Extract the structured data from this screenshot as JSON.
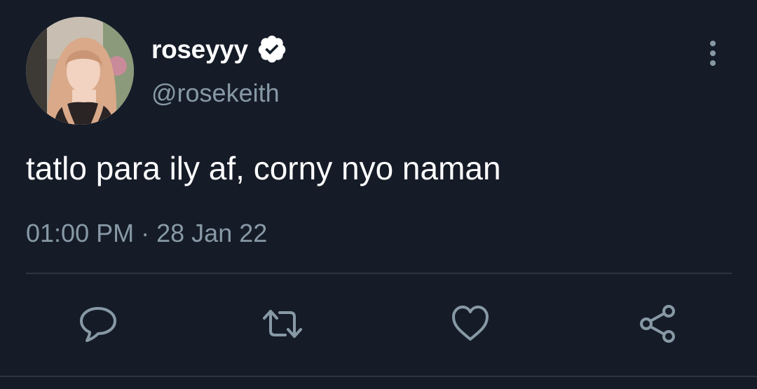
{
  "tweet": {
    "author": {
      "display_name": "roseyyy",
      "handle": "@rosekeith",
      "verified": true,
      "avatar_icon": "profile-photo"
    },
    "text": "tatlo para ily af, corny nyo naman",
    "time": "01:00 PM",
    "separator": "·",
    "date": "28 Jan 22"
  },
  "actions": [
    {
      "name": "reply",
      "icon": "reply-icon"
    },
    {
      "name": "retweet",
      "icon": "retweet-icon"
    },
    {
      "name": "like",
      "icon": "heart-icon"
    },
    {
      "name": "share",
      "icon": "share-icon"
    }
  ],
  "colors": {
    "background": "#151c28",
    "primary_text": "#ffffff",
    "secondary_text": "#8899a6",
    "divider": "#2b3541"
  }
}
